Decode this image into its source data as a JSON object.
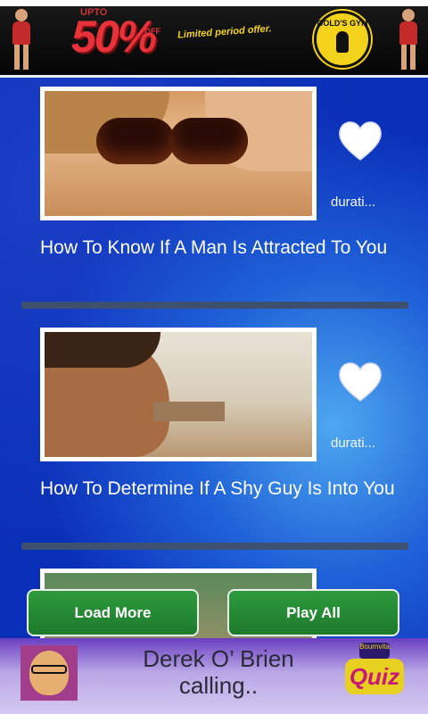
{
  "top_ad": {
    "upto": "UPTO",
    "percent": "50%",
    "off": "OFF",
    "offer": "Limited period offer.",
    "brand": "GOLD'S GYM"
  },
  "videos": [
    {
      "title": "How To Know If A Man Is Attracted To You",
      "duration": "durati..."
    },
    {
      "title": "How To Determine If A Shy Guy Is Into You",
      "duration": "durati..."
    }
  ],
  "buttons": {
    "load_more": "Load More",
    "play_all": "Play All"
  },
  "bottom_ad": {
    "caller": "Derek O’ Brien calling..",
    "quiz_top": "Bournvita",
    "quiz": "Quiz"
  },
  "colors": {
    "background": "#0a2fb8",
    "button_green": "#2e9a3e",
    "divider": "#3e5070"
  }
}
